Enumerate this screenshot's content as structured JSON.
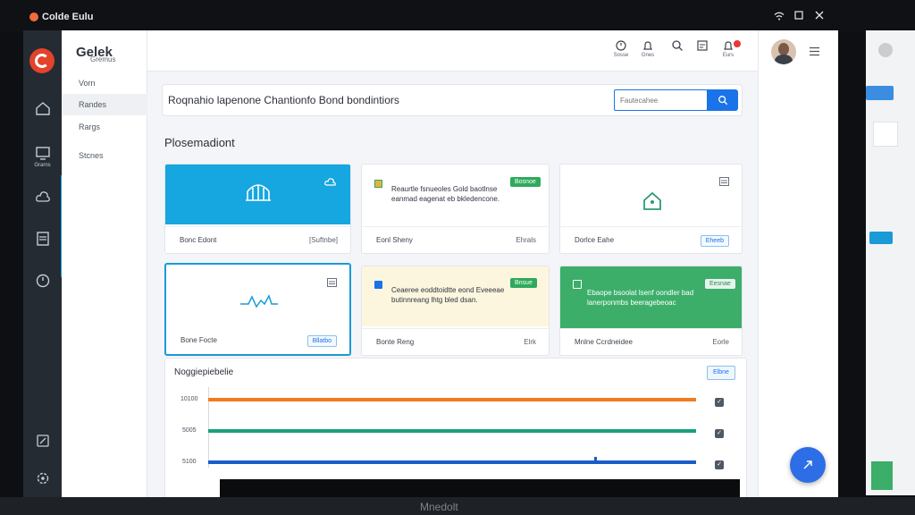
{
  "os": {
    "title": "Colde Eulu"
  },
  "app": {
    "brand": "Gelek",
    "brand_accent": "k",
    "brand_sub": "Gremus"
  },
  "iconbar": {
    "items": [
      {
        "icon": "home-icon",
        "caption": ""
      },
      {
        "icon": "monitor-icon",
        "caption": "Grarns"
      },
      {
        "icon": "cloud-icon",
        "caption": ""
      },
      {
        "icon": "document-list-icon",
        "caption": ""
      },
      {
        "icon": "compass-icon",
        "caption": ""
      },
      {
        "icon": "edit-icon",
        "caption": ""
      },
      {
        "icon": "settings-icon",
        "caption": ""
      }
    ]
  },
  "nav": {
    "items": [
      {
        "label": "Vorn"
      },
      {
        "label": "Randes"
      },
      {
        "label": "Rargs"
      },
      {
        "label": "Stcnes"
      }
    ]
  },
  "topbar": {
    "icons": [
      {
        "icon": "clock-icon",
        "caption": "Sosse"
      },
      {
        "icon": "bell-icon",
        "caption": "Gnes"
      },
      {
        "icon": "search-icon",
        "caption": ""
      },
      {
        "icon": "calendar-icon",
        "caption": ""
      },
      {
        "icon": "notification-icon",
        "caption": "Eurs"
      }
    ]
  },
  "header": {
    "title": "Roqnahio lapenone Chantionfo Bond bondintiors",
    "search_placeholder": "Fautecahee"
  },
  "section_title": "Plosemadiont",
  "cards": [
    {
      "footer_left": "Bonc Edont",
      "footer_right": "[Suftnbe]",
      "variant": "hero-blue"
    },
    {
      "footer_left": "Eonl Sheny",
      "footer_right": "Ehrals",
      "chip": "Bosnoe",
      "text": "Reaurtle fsnueoles Gold baotlnse eanmad eagenat eb bkledencone.",
      "variant": "text"
    },
    {
      "footer_left": "Dorlce Eahe",
      "footer_right": "Eheeb",
      "variant": "icon"
    },
    {
      "footer_left": "Bone Focte",
      "footer_right": "Bllatbo",
      "variant": "chart"
    },
    {
      "footer_left": "Bonte Reng",
      "footer_right": "Elrk",
      "chip": "Bnsue",
      "text": "Ceaeree eoddtoidtte eond Eveeeae butinnreang lhtg bled dsan.",
      "variant": "yellow"
    },
    {
      "footer_left": "Mnlne Ccrdneidee",
      "footer_right": "Eorle",
      "chip": "Eesnae",
      "text": "Ebaope bsoolat lsenf oondler bad lanerponmbs beeragebeoac",
      "variant": "green"
    }
  ],
  "chart_data": {
    "type": "line",
    "title": "Noggiepiebelie",
    "button": "Elbne",
    "yticks": [
      "10100",
      "5005",
      "5100"
    ],
    "series": [
      {
        "color": "#f07c1f",
        "values": [
          10100,
          10100
        ]
      },
      {
        "color": "#1aa07f",
        "values": [
          5005,
          5005
        ]
      },
      {
        "color": "#1a5dc8",
        "values": [
          5100,
          5100
        ]
      }
    ]
  },
  "laptop_brand": "Mnedolt",
  "colors": {
    "accent": "#1a73e8",
    "hero": "#16a6e0",
    "green": "#3cae6a",
    "yellow": "#fcf6de"
  }
}
